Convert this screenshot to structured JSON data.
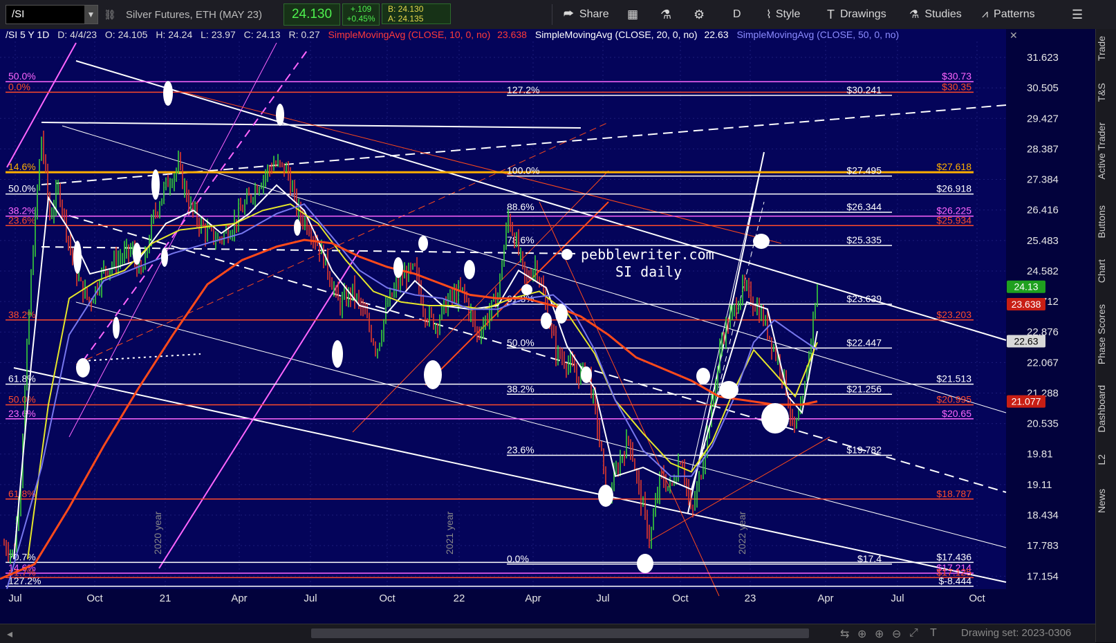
{
  "toolbar": {
    "symbol": "/SI",
    "description": "Silver Futures, ETH (MAY 23)",
    "last": "24.130",
    "change": "+.109",
    "change_pct": "+0.45%",
    "bid": "B: 24.130",
    "ask": "A: 24.135",
    "share_label": "Share",
    "period_label": "D",
    "style_label": "Style",
    "drawings_label": "Drawings",
    "studies_label": "Studies",
    "patterns_label": "Patterns"
  },
  "header": {
    "info": "/SI 5 Y 1D",
    "date": "D: 4/4/23",
    "open": "O: 24.105",
    "high": "H: 24.24",
    "low": "L: 23.97",
    "close": "C: 24.13",
    "range": "R: 0.27",
    "sma10_label": "SimpleMovingAvg (CLOSE, 10, 0, no)",
    "sma10_value": "23.638",
    "sma20_label": "SimpleMovingAvg (CLOSE, 20, 0, no)",
    "sma20_value": "22.63",
    "sma50_label": "SimpleMovingAvg (CLOSE, 50, 0, no)"
  },
  "watermark": {
    "line1": "pebblewriter.com",
    "line2": "SI daily"
  },
  "right_tabs": [
    "Trade",
    "T&S",
    "Active Trader",
    "Buttons",
    "Chart",
    "Phase Scores",
    "Dashboard",
    "L2",
    "News"
  ],
  "bottom": {
    "drawing_set": "Drawing set: 2023-0306"
  },
  "colors": {
    "background": "#04045a",
    "price_up": "#3ad13a",
    "price_down": "#e23a2a",
    "sma10": "#ffffff",
    "sma20": "#e6e62a",
    "sma50": "#7777ee",
    "sma_long": "#ff4a1a",
    "fib_white": "#ffffff",
    "fib_red": "#ff4a2a",
    "fib_magenta": "#ff66ff",
    "fib_orange": "#ffb000"
  },
  "chart_data": {
    "type": "line",
    "title": "/SI 5 Y 1D",
    "ylim": [
      16.9,
      32.2
    ],
    "log_scale": true,
    "y_ticks": [
      "31.623",
      "30.505",
      "29.427",
      "28.387",
      "27.384",
      "26.416",
      "25.483",
      "24.582",
      "23.712",
      "22.876",
      "22.067",
      "21.288",
      "20.535",
      "19.81",
      "19.11",
      "18.434",
      "17.783",
      "17.154"
    ],
    "x_ticks": [
      "Jul",
      "Oct",
      "21",
      "Apr",
      "Jul",
      "Oct",
      "22",
      "Apr",
      "Jul",
      "Oct",
      "23",
      "Apr",
      "Jul",
      "Oct"
    ],
    "vertical_labels": [
      "2020 year",
      "2021 year",
      "2022 year"
    ],
    "badges": [
      {
        "text": "24.13",
        "value": 24.13,
        "color": "#1fa01f"
      },
      {
        "text": "23.638",
        "value": 23.638,
        "color": "#c81e14"
      },
      {
        "text": "22.63",
        "value": 22.63,
        "color": "#d8d8d8"
      },
      {
        "text": "21.077",
        "value": 21.077,
        "color": "#c81e14"
      }
    ],
    "fib_center": [
      {
        "label": "127.2%",
        "value": 30.241,
        "value_text": "$30.241"
      },
      {
        "label": "100.0%",
        "value": 27.495,
        "value_text": "$27.495"
      },
      {
        "label": "88.6%",
        "value": 26.344,
        "value_text": "$26.344"
      },
      {
        "label": "78.6%",
        "value": 25.335,
        "value_text": "$25.335"
      },
      {
        "label": "61.8%",
        "value": 23.639,
        "value_text": "$23.639"
      },
      {
        "label": "50.0%",
        "value": 22.447,
        "value_text": "$22.447"
      },
      {
        "label": "38.2%",
        "value": 21.256,
        "value_text": "$21.256"
      },
      {
        "label": "23.6%",
        "value": 19.782,
        "value_text": "$19.782"
      },
      {
        "label": "0.0%",
        "value": 17.4,
        "value_text": "$17.4"
      }
    ],
    "levels_right": [
      {
        "value": 30.73,
        "text": "$30.73",
        "color": "#ff66ff",
        "left_label": "50.0%"
      },
      {
        "value": 30.35,
        "text": "$30.35",
        "color": "#ff4a2a",
        "left_label": "0.0%"
      },
      {
        "value": 27.618,
        "text": "$27.618",
        "color": "#ffb000",
        "left_label": "14.6%"
      },
      {
        "value": 26.918,
        "text": "$26.918",
        "color": "#ffffff",
        "left_label": "50.0%"
      },
      {
        "value": 26.225,
        "text": "$26.225",
        "color": "#ff66ff",
        "left_label": "38.2%"
      },
      {
        "value": 25.934,
        "text": "$25.934",
        "color": "#ff4a2a",
        "left_label": "23.6%"
      },
      {
        "value": 23.203,
        "text": "$23.203",
        "color": "#ff4a2a",
        "left_label": "38.2%"
      },
      {
        "value": 21.513,
        "text": "$21.513",
        "color": "#ffffff",
        "left_label": "61.8%"
      },
      {
        "value": 20.995,
        "text": "$20.995",
        "color": "#ff4a2a",
        "left_label": "50.0%"
      },
      {
        "value": 20.65,
        "text": "$20.65",
        "color": "#ff66ff",
        "left_label": "23.6%"
      },
      {
        "value": 18.787,
        "text": "$18.787",
        "color": "#ff4a2a",
        "left_label": "61.8%"
      },
      {
        "value": 17.436,
        "text": "$17.436",
        "color": "#ffffff",
        "left_label": "70.7%"
      },
      {
        "value": 17.214,
        "text": "$17.214",
        "color": "#ff66ff",
        "left_label": "14.6%"
      },
      {
        "value": 17.125,
        "text": "$17.125",
        "color": "#ff4a2a",
        "left_label": "41.7%"
      },
      {
        "value": 16.95,
        "text": "$-8.444",
        "color": "#ffffff",
        "left_label": "127.2%"
      }
    ],
    "price_path": [
      [
        0,
        17.9
      ],
      [
        20,
        17.6
      ],
      [
        30,
        19.3
      ],
      [
        45,
        24.4
      ],
      [
        60,
        28.8
      ],
      [
        72,
        26.2
      ],
      [
        85,
        27.1
      ],
      [
        100,
        25.4
      ],
      [
        115,
        24.2
      ],
      [
        130,
        23.7
      ],
      [
        150,
        24.6
      ],
      [
        170,
        24.9
      ],
      [
        190,
        25.2
      ],
      [
        205,
        24.4
      ],
      [
        222,
        26.2
      ],
      [
        240,
        27.2
      ],
      [
        258,
        27.8
      ],
      [
        275,
        26.5
      ],
      [
        295,
        25.8
      ],
      [
        315,
        25.5
      ],
      [
        335,
        25.9
      ],
      [
        355,
        26.6
      ],
      [
        375,
        27.3
      ],
      [
        395,
        27.9
      ],
      [
        415,
        27.7
      ],
      [
        430,
        26.4
      ],
      [
        450,
        25.8
      ],
      [
        470,
        24.9
      ],
      [
        490,
        23.6
      ],
      [
        510,
        24.0
      ],
      [
        530,
        23.2
      ],
      [
        545,
        22.4
      ],
      [
        560,
        23.6
      ],
      [
        580,
        24.4
      ],
      [
        600,
        24.6
      ],
      [
        615,
        23.4
      ],
      [
        630,
        23.1
      ],
      [
        650,
        23.8
      ],
      [
        670,
        24.0
      ],
      [
        690,
        22.8
      ],
      [
        705,
        23.3
      ],
      [
        720,
        23.9
      ],
      [
        735,
        26.2
      ],
      [
        748,
        25.3
      ],
      [
        760,
        24.3
      ],
      [
        775,
        24.8
      ],
      [
        790,
        23.5
      ],
      [
        805,
        22.3
      ],
      [
        820,
        22.1
      ],
      [
        835,
        21.7
      ],
      [
        850,
        21.9
      ],
      [
        865,
        20.4
      ],
      [
        878,
        18.7
      ],
      [
        895,
        19.6
      ],
      [
        910,
        20.2
      ],
      [
        925,
        18.9
      ],
      [
        940,
        17.9
      ],
      [
        955,
        19.3
      ],
      [
        970,
        19.0
      ],
      [
        985,
        19.8
      ],
      [
        1000,
        18.4
      ],
      [
        1015,
        19.5
      ],
      [
        1030,
        21.0
      ],
      [
        1045,
        22.8
      ],
      [
        1060,
        23.4
      ],
      [
        1075,
        24.1
      ],
      [
        1090,
        23.7
      ],
      [
        1105,
        23.2
      ],
      [
        1120,
        22.4
      ],
      [
        1135,
        21.6
      ],
      [
        1148,
        20.3
      ],
      [
        1160,
        20.9
      ],
      [
        1170,
        22.3
      ],
      [
        1182,
        24.13
      ]
    ],
    "series": [
      {
        "name": "SimpleMovingAvg (CLOSE, 10, 0, no)",
        "color": "#ffffff",
        "points": [
          [
            20,
            17.5
          ],
          [
            45,
            22.0
          ],
          [
            70,
            26.8
          ],
          [
            100,
            25.8
          ],
          [
            130,
            24.5
          ],
          [
            170,
            24.7
          ],
          [
            200,
            24.9
          ],
          [
            240,
            26.0
          ],
          [
            280,
            26.4
          ],
          [
            320,
            25.7
          ],
          [
            360,
            26.3
          ],
          [
            400,
            27.2
          ],
          [
            440,
            26.4
          ],
          [
            480,
            24.6
          ],
          [
            520,
            23.6
          ],
          [
            560,
            23.4
          ],
          [
            600,
            24.3
          ],
          [
            640,
            23.6
          ],
          [
            680,
            23.5
          ],
          [
            720,
            23.6
          ],
          [
            750,
            24.6
          ],
          [
            790,
            24.1
          ],
          [
            820,
            22.5
          ],
          [
            860,
            21.4
          ],
          [
            890,
            19.3
          ],
          [
            930,
            19.5
          ],
          [
            970,
            19.2
          ],
          [
            1000,
            19.0
          ],
          [
            1040,
            21.3
          ],
          [
            1080,
            23.7
          ],
          [
            1110,
            23.5
          ],
          [
            1140,
            21.2
          ],
          [
            1160,
            20.8
          ],
          [
            1182,
            22.9
          ]
        ]
      },
      {
        "name": "SimpleMovingAvg (CLOSE, 20, 0, no)",
        "color": "#e6e62a",
        "points": [
          [
            40,
            17.5
          ],
          [
            70,
            21.0
          ],
          [
            100,
            23.8
          ],
          [
            140,
            24.3
          ],
          [
            180,
            24.6
          ],
          [
            220,
            25.4
          ],
          [
            260,
            25.8
          ],
          [
            300,
            25.9
          ],
          [
            340,
            26.0
          ],
          [
            380,
            26.4
          ],
          [
            420,
            26.6
          ],
          [
            460,
            26.0
          ],
          [
            500,
            24.9
          ],
          [
            540,
            24.0
          ],
          [
            580,
            23.7
          ],
          [
            620,
            23.6
          ],
          [
            660,
            23.6
          ],
          [
            700,
            23.5
          ],
          [
            740,
            23.8
          ],
          [
            780,
            24.0
          ],
          [
            820,
            23.4
          ],
          [
            860,
            22.3
          ],
          [
            890,
            21.1
          ],
          [
            930,
            20.3
          ],
          [
            970,
            19.6
          ],
          [
            1000,
            19.4
          ],
          [
            1030,
            20.1
          ],
          [
            1060,
            21.3
          ],
          [
            1090,
            22.4
          ],
          [
            1120,
            21.8
          ],
          [
            1150,
            21.2
          ],
          [
            1182,
            22.6
          ]
        ]
      },
      {
        "name": "SimpleMovingAvg (CLOSE, 50, 0, no)",
        "color": "#7777ee",
        "points": [
          [
            10,
            16.9
          ],
          [
            60,
            19.5
          ],
          [
            100,
            22.8
          ],
          [
            150,
            24.3
          ],
          [
            200,
            24.7
          ],
          [
            250,
            25.1
          ],
          [
            300,
            25.4
          ],
          [
            350,
            25.7
          ],
          [
            400,
            26.3
          ],
          [
            440,
            26.6
          ],
          [
            480,
            25.6
          ],
          [
            520,
            24.6
          ],
          [
            560,
            24.1
          ],
          [
            600,
            23.9
          ],
          [
            640,
            23.8
          ],
          [
            680,
            23.5
          ],
          [
            720,
            23.5
          ],
          [
            760,
            23.8
          ],
          [
            800,
            23.9
          ],
          [
            830,
            23.4
          ],
          [
            860,
            22.4
          ],
          [
            890,
            21.1
          ],
          [
            930,
            19.9
          ],
          [
            970,
            19.3
          ],
          [
            1000,
            19.3
          ],
          [
            1030,
            20.0
          ],
          [
            1060,
            21.1
          ],
          [
            1090,
            22.6
          ],
          [
            1120,
            23.2
          ],
          [
            1150,
            22.8
          ],
          [
            1182,
            22.4
          ]
        ]
      },
      {
        "name": "long moving average",
        "color": "#ff4a1a",
        "points": [
          [
            0,
            17.1
          ],
          [
            50,
            17.4
          ],
          [
            100,
            18.6
          ],
          [
            150,
            20.0
          ],
          [
            200,
            21.4
          ],
          [
            250,
            22.8
          ],
          [
            300,
            24.2
          ],
          [
            350,
            24.9
          ],
          [
            400,
            25.3
          ],
          [
            440,
            25.5
          ],
          [
            480,
            25.4
          ],
          [
            520,
            25.0
          ],
          [
            560,
            24.7
          ],
          [
            600,
            24.5
          ],
          [
            640,
            24.2
          ],
          [
            680,
            23.9
          ],
          [
            720,
            23.8
          ],
          [
            760,
            23.8
          ],
          [
            800,
            23.6
          ],
          [
            840,
            23.3
          ],
          [
            880,
            22.8
          ],
          [
            920,
            22.2
          ],
          [
            960,
            21.9
          ],
          [
            1000,
            21.6
          ],
          [
            1040,
            21.2
          ],
          [
            1080,
            21.1
          ],
          [
            1120,
            21.0
          ],
          [
            1160,
            21.0
          ],
          [
            1182,
            21.08
          ]
        ]
      }
    ]
  }
}
